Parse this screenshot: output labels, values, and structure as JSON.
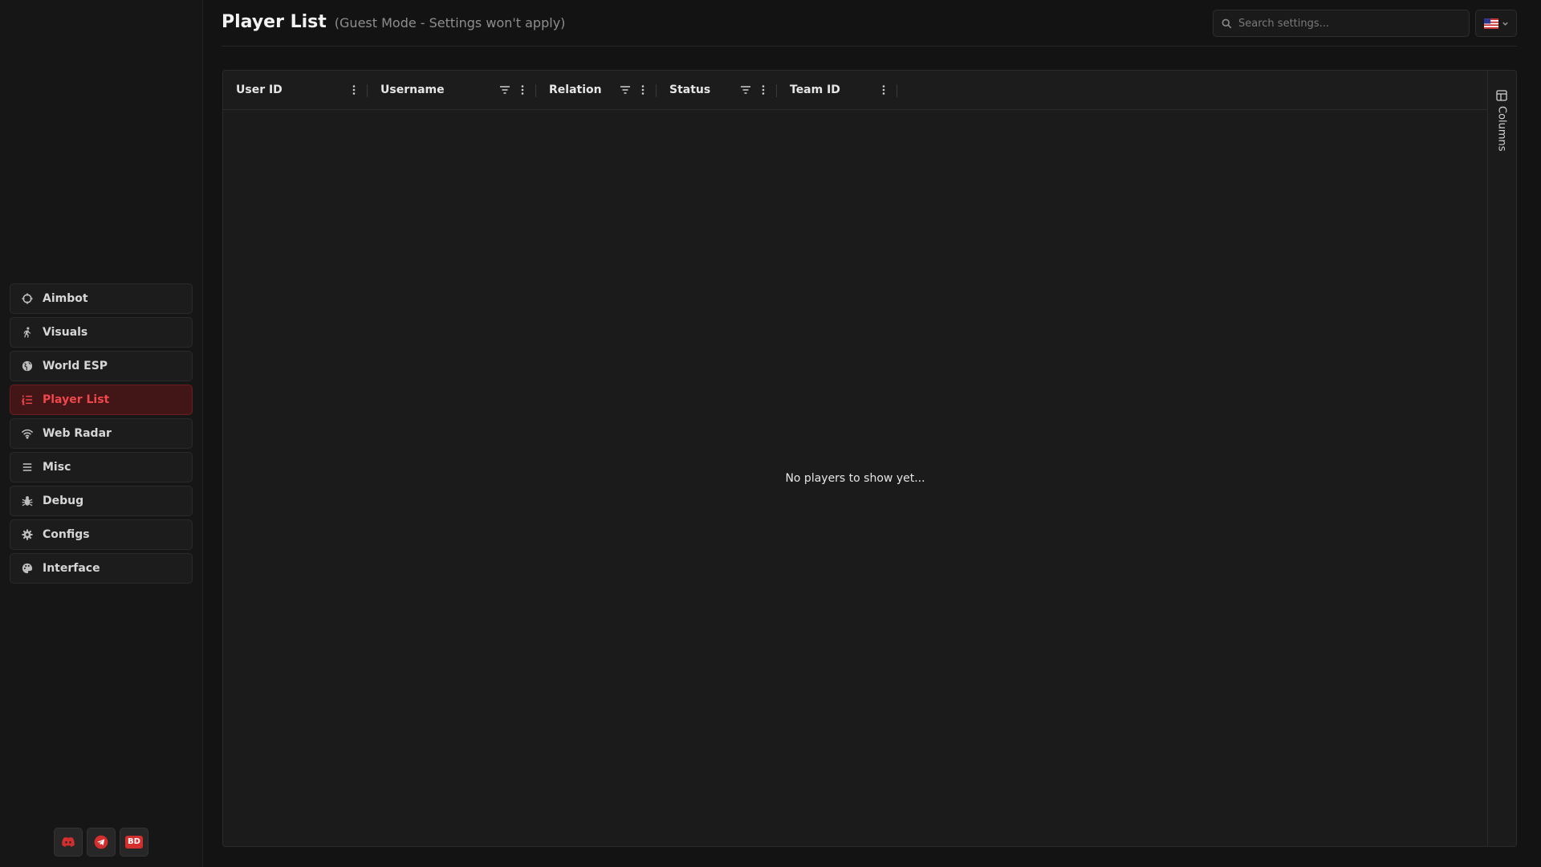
{
  "header": {
    "title": "Player List",
    "subtitle": "(Guest Mode - Settings won't apply)",
    "search_placeholder": "Search settings...",
    "language_flag": "us-flag-icon"
  },
  "sidebar": {
    "items": [
      {
        "label": "Aimbot",
        "icon": "crosshair-icon"
      },
      {
        "label": "Visuals",
        "icon": "running-person-icon"
      },
      {
        "label": "World ESP",
        "icon": "globe-icon"
      },
      {
        "label": "Player List",
        "icon": "list-ordered-icon",
        "active": true
      },
      {
        "label": "Web Radar",
        "icon": "wifi-icon"
      },
      {
        "label": "Misc",
        "icon": "menu-icon"
      },
      {
        "label": "Debug",
        "icon": "bug-icon"
      },
      {
        "label": "Configs",
        "icon": "gear-icon"
      },
      {
        "label": "Interface",
        "icon": "palette-icon"
      }
    ],
    "socials": [
      {
        "name": "discord",
        "icon": "discord-icon"
      },
      {
        "name": "telegram",
        "icon": "telegram-icon"
      },
      {
        "name": "bd",
        "label": "BD"
      }
    ]
  },
  "table": {
    "columns": [
      {
        "label": "User ID",
        "filter": false
      },
      {
        "label": "Username",
        "filter": true
      },
      {
        "label": "Relation",
        "filter": true
      },
      {
        "label": "Status",
        "filter": true
      },
      {
        "label": "Team ID",
        "filter": false
      }
    ],
    "empty_message": "No players to show yet...",
    "columns_panel_label": "Columns"
  },
  "colors": {
    "accent": "#f0474b",
    "active_bg": "#421517",
    "background": "#131313",
    "panel": "#1b1b1b"
  }
}
